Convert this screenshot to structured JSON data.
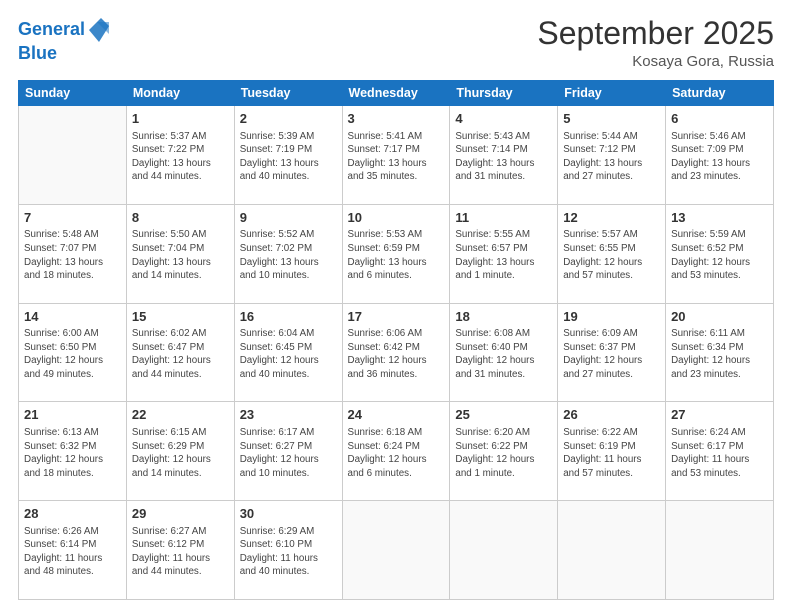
{
  "header": {
    "logo_line1": "General",
    "logo_line2": "Blue",
    "month_year": "September 2025",
    "location": "Kosaya Gora, Russia"
  },
  "weekdays": [
    "Sunday",
    "Monday",
    "Tuesday",
    "Wednesday",
    "Thursday",
    "Friday",
    "Saturday"
  ],
  "weeks": [
    [
      {
        "day": "",
        "info": ""
      },
      {
        "day": "1",
        "info": "Sunrise: 5:37 AM\nSunset: 7:22 PM\nDaylight: 13 hours\nand 44 minutes."
      },
      {
        "day": "2",
        "info": "Sunrise: 5:39 AM\nSunset: 7:19 PM\nDaylight: 13 hours\nand 40 minutes."
      },
      {
        "day": "3",
        "info": "Sunrise: 5:41 AM\nSunset: 7:17 PM\nDaylight: 13 hours\nand 35 minutes."
      },
      {
        "day": "4",
        "info": "Sunrise: 5:43 AM\nSunset: 7:14 PM\nDaylight: 13 hours\nand 31 minutes."
      },
      {
        "day": "5",
        "info": "Sunrise: 5:44 AM\nSunset: 7:12 PM\nDaylight: 13 hours\nand 27 minutes."
      },
      {
        "day": "6",
        "info": "Sunrise: 5:46 AM\nSunset: 7:09 PM\nDaylight: 13 hours\nand 23 minutes."
      }
    ],
    [
      {
        "day": "7",
        "info": "Sunrise: 5:48 AM\nSunset: 7:07 PM\nDaylight: 13 hours\nand 18 minutes."
      },
      {
        "day": "8",
        "info": "Sunrise: 5:50 AM\nSunset: 7:04 PM\nDaylight: 13 hours\nand 14 minutes."
      },
      {
        "day": "9",
        "info": "Sunrise: 5:52 AM\nSunset: 7:02 PM\nDaylight: 13 hours\nand 10 minutes."
      },
      {
        "day": "10",
        "info": "Sunrise: 5:53 AM\nSunset: 6:59 PM\nDaylight: 13 hours\nand 6 minutes."
      },
      {
        "day": "11",
        "info": "Sunrise: 5:55 AM\nSunset: 6:57 PM\nDaylight: 13 hours\nand 1 minute."
      },
      {
        "day": "12",
        "info": "Sunrise: 5:57 AM\nSunset: 6:55 PM\nDaylight: 12 hours\nand 57 minutes."
      },
      {
        "day": "13",
        "info": "Sunrise: 5:59 AM\nSunset: 6:52 PM\nDaylight: 12 hours\nand 53 minutes."
      }
    ],
    [
      {
        "day": "14",
        "info": "Sunrise: 6:00 AM\nSunset: 6:50 PM\nDaylight: 12 hours\nand 49 minutes."
      },
      {
        "day": "15",
        "info": "Sunrise: 6:02 AM\nSunset: 6:47 PM\nDaylight: 12 hours\nand 44 minutes."
      },
      {
        "day": "16",
        "info": "Sunrise: 6:04 AM\nSunset: 6:45 PM\nDaylight: 12 hours\nand 40 minutes."
      },
      {
        "day": "17",
        "info": "Sunrise: 6:06 AM\nSunset: 6:42 PM\nDaylight: 12 hours\nand 36 minutes."
      },
      {
        "day": "18",
        "info": "Sunrise: 6:08 AM\nSunset: 6:40 PM\nDaylight: 12 hours\nand 31 minutes."
      },
      {
        "day": "19",
        "info": "Sunrise: 6:09 AM\nSunset: 6:37 PM\nDaylight: 12 hours\nand 27 minutes."
      },
      {
        "day": "20",
        "info": "Sunrise: 6:11 AM\nSunset: 6:34 PM\nDaylight: 12 hours\nand 23 minutes."
      }
    ],
    [
      {
        "day": "21",
        "info": "Sunrise: 6:13 AM\nSunset: 6:32 PM\nDaylight: 12 hours\nand 18 minutes."
      },
      {
        "day": "22",
        "info": "Sunrise: 6:15 AM\nSunset: 6:29 PM\nDaylight: 12 hours\nand 14 minutes."
      },
      {
        "day": "23",
        "info": "Sunrise: 6:17 AM\nSunset: 6:27 PM\nDaylight: 12 hours\nand 10 minutes."
      },
      {
        "day": "24",
        "info": "Sunrise: 6:18 AM\nSunset: 6:24 PM\nDaylight: 12 hours\nand 6 minutes."
      },
      {
        "day": "25",
        "info": "Sunrise: 6:20 AM\nSunset: 6:22 PM\nDaylight: 12 hours\nand 1 minute."
      },
      {
        "day": "26",
        "info": "Sunrise: 6:22 AM\nSunset: 6:19 PM\nDaylight: 11 hours\nand 57 minutes."
      },
      {
        "day": "27",
        "info": "Sunrise: 6:24 AM\nSunset: 6:17 PM\nDaylight: 11 hours\nand 53 minutes."
      }
    ],
    [
      {
        "day": "28",
        "info": "Sunrise: 6:26 AM\nSunset: 6:14 PM\nDaylight: 11 hours\nand 48 minutes."
      },
      {
        "day": "29",
        "info": "Sunrise: 6:27 AM\nSunset: 6:12 PM\nDaylight: 11 hours\nand 44 minutes."
      },
      {
        "day": "30",
        "info": "Sunrise: 6:29 AM\nSunset: 6:10 PM\nDaylight: 11 hours\nand 40 minutes."
      },
      {
        "day": "",
        "info": ""
      },
      {
        "day": "",
        "info": ""
      },
      {
        "day": "",
        "info": ""
      },
      {
        "day": "",
        "info": ""
      }
    ]
  ]
}
